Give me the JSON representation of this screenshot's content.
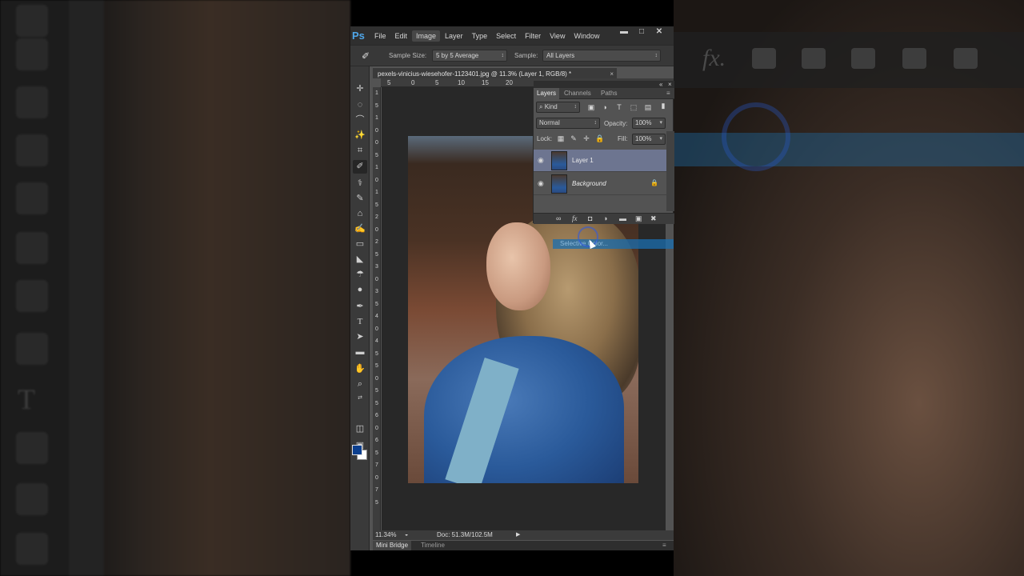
{
  "app": {
    "logo": "Ps"
  },
  "menu": [
    "File",
    "Edit",
    "Image",
    "Layer",
    "Type",
    "Select",
    "Filter",
    "View",
    "Window"
  ],
  "menu_active": "Image",
  "window_controls": {
    "minimize": "▬",
    "maximize": "□",
    "close": "✕"
  },
  "options": {
    "sample_size_label": "Sample Size:",
    "sample_size_value": "5 by 5 Average",
    "sample_label": "Sample:",
    "sample_value": "All Layers"
  },
  "document": {
    "tab_title": "pexels-vinicius-wiesehofer-1123401.jpg @ 11.3% (Layer 1, RGB/8) *",
    "close": "×"
  },
  "ruler_h": [
    "5",
    "0",
    "5",
    "10",
    "15",
    "20"
  ],
  "ruler_v": [
    "1",
    "5",
    "1",
    "0",
    "0",
    "5",
    "1",
    "0",
    "1",
    "5",
    "2",
    "0",
    "2",
    "5",
    "3",
    "0",
    "3",
    "5",
    "4",
    "0",
    "4",
    "5",
    "5",
    "0",
    "5",
    "5",
    "6",
    "0",
    "6",
    "5",
    "7",
    "0",
    "7",
    "5"
  ],
  "status": {
    "zoom": "11.34%",
    "doc": "Doc: 51.3M/102.5M"
  },
  "bottom_tabs": [
    "Mini Bridge",
    "Timeline"
  ],
  "layers_panel": {
    "tabs": [
      "Layers",
      "Channels",
      "Paths"
    ],
    "filter": "Kind",
    "blend_mode": "Normal",
    "opacity_label": "Opacity:",
    "opacity_value": "100%",
    "lock_label": "Lock:",
    "fill_label": "Fill:",
    "fill_value": "100%",
    "layers": [
      {
        "name": "Layer 1",
        "selected": true,
        "locked": false
      },
      {
        "name": "Background",
        "selected": false,
        "locked": true
      }
    ],
    "collapse": "«",
    "close": "×"
  },
  "tooltip": {
    "text": "Selective Color..."
  },
  "colors": {
    "foreground": "#0c3f8e",
    "background": "#ffffff",
    "ps_blue": "#4fa6e8",
    "selection": "#6d7590"
  }
}
